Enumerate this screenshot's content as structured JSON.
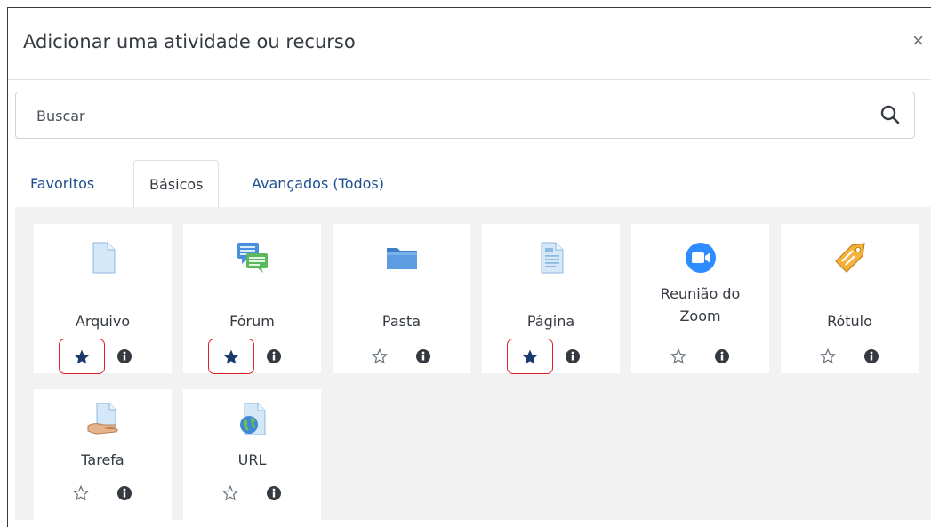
{
  "modal": {
    "title": "Adicionar uma atividade ou recurso",
    "close": "×"
  },
  "search": {
    "placeholder": "Buscar"
  },
  "tabs": [
    {
      "label": "Favoritos",
      "active": false
    },
    {
      "label": "Básicos",
      "active": true
    },
    {
      "label": "Avançados (Todos)",
      "active": false
    }
  ],
  "items": [
    {
      "label_lines": [
        "Arquivo"
      ],
      "icon": "file-icon",
      "starred": true,
      "highlighted": true
    },
    {
      "label_lines": [
        "Fórum"
      ],
      "icon": "forum-icon",
      "starred": true,
      "highlighted": true
    },
    {
      "label_lines": [
        "Pasta"
      ],
      "icon": "folder-icon",
      "starred": false,
      "highlighted": false
    },
    {
      "label_lines": [
        "Página"
      ],
      "icon": "page-icon",
      "starred": true,
      "highlighted": true
    },
    {
      "label_lines": [
        "Reunião do",
        "Zoom"
      ],
      "icon": "zoom-icon",
      "starred": false,
      "highlighted": false
    },
    {
      "label_lines": [
        "Rótulo"
      ],
      "icon": "label-icon",
      "starred": false,
      "highlighted": false
    },
    {
      "label_lines": [
        "Tarefa"
      ],
      "icon": "assignment-icon",
      "starred": false,
      "highlighted": false
    },
    {
      "label_lines": [
        "URL"
      ],
      "icon": "url-icon",
      "starred": false,
      "highlighted": false
    }
  ],
  "colors": {
    "star_filled": "#1b3a6b",
    "star_outline": "#6c757d",
    "highlight_border": "#e0202a",
    "tab_link": "#1d4f91",
    "zoom_blue": "#2d8cff",
    "tag_orange": "#f0a030"
  }
}
